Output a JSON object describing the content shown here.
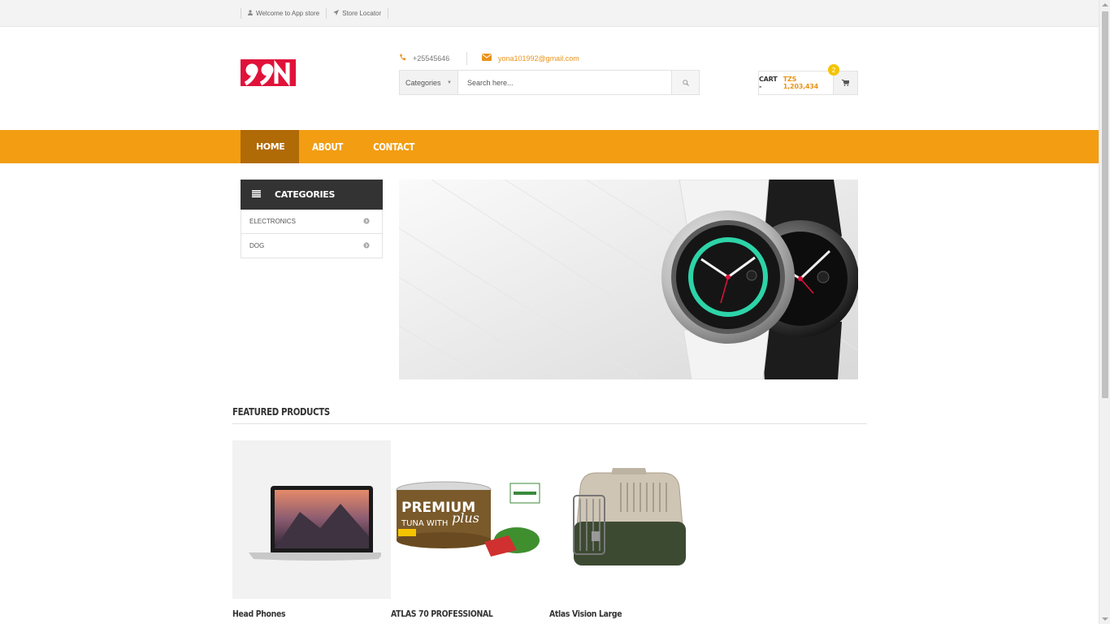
{
  "topbar": {
    "links": [
      {
        "label": "Welcome to App store",
        "icon": "user-icon"
      },
      {
        "label": "Store Locator",
        "icon": "location-arrow-icon"
      }
    ]
  },
  "header": {
    "logo_text": "99N",
    "phone": "+25545646",
    "email": "yona101992@gmail.com",
    "search": {
      "category_label": "Categories",
      "placeholder": "Search here..."
    },
    "cart": {
      "label": "CART -",
      "amount": "TZS 1,203,434",
      "count": "2"
    }
  },
  "nav": {
    "items": [
      {
        "label": "HOME",
        "active": true
      },
      {
        "label": "ABOUT",
        "active": false
      },
      {
        "label": "CONTACT",
        "active": false
      }
    ]
  },
  "categories": {
    "title": "CATEGORIES",
    "items": [
      "ELECTRONICS",
      "DOG"
    ]
  },
  "featured": {
    "title": "FEATURED PRODUCTS",
    "products": [
      {
        "name": "Head Phones",
        "image": "laptop"
      },
      {
        "name": "ATLAS 70 PROFESSIONAL",
        "image": "cat-food-can"
      },
      {
        "name": "Atlas Vision Large",
        "image": "pet-carrier"
      }
    ]
  },
  "colors": {
    "accent": "#f29d12",
    "accent_dark": "#b06a06",
    "logo_red": "#e0123a",
    "dark": "#333333"
  }
}
